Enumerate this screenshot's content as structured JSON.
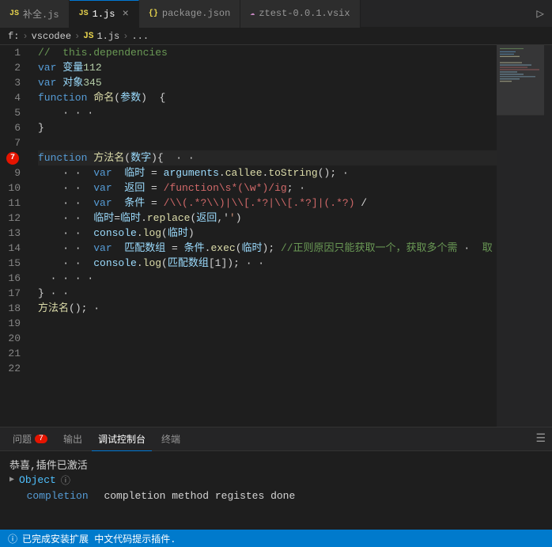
{
  "tabs": [
    {
      "id": "buquan",
      "icon": "JS",
      "icon_class": "tab-icon",
      "label": "补全.js",
      "active": false,
      "closeable": false
    },
    {
      "id": "1js",
      "icon": "JS",
      "icon_class": "tab-icon",
      "label": "1.js",
      "active": true,
      "closeable": true
    },
    {
      "id": "package",
      "icon": "{}",
      "icon_class": "tab-icon json",
      "label": "package.json",
      "active": false,
      "closeable": false
    },
    {
      "id": "vsix",
      "icon": "☁",
      "icon_class": "tab-icon vsix",
      "label": "ztest-0.0.1.vsix",
      "active": false,
      "closeable": false
    }
  ],
  "breadcrumb": {
    "items": [
      "f:",
      "vscodee",
      "JS",
      "1.js",
      "..."
    ]
  },
  "lines": [
    {
      "num": 1,
      "content": "comment_this_dependencies"
    },
    {
      "num": 2,
      "content": "var_112"
    },
    {
      "num": 3,
      "content": "var_345"
    },
    {
      "num": 4,
      "content": "function_named"
    },
    {
      "num": 5,
      "content": "dots"
    },
    {
      "num": 6,
      "content": "close_brace"
    },
    {
      "num": 7,
      "content": "empty"
    },
    {
      "num": 8,
      "content": "function_shuzhi"
    },
    {
      "num": 9,
      "content": "var_linshi_arguments"
    },
    {
      "num": 10,
      "content": "var_fanhui_regex"
    },
    {
      "num": 11,
      "content": "var_tiaojian"
    },
    {
      "num": 12,
      "content": "linshi_replace"
    },
    {
      "num": 13,
      "content": "console_log_linshi"
    },
    {
      "num": 14,
      "content": "var_pipeidingzu"
    },
    {
      "num": 15,
      "content": "console_log_pipeidingzu"
    },
    {
      "num": 16,
      "content": "dots2"
    },
    {
      "num": 17,
      "content": "empty2"
    },
    {
      "num": 18,
      "content": "method_call"
    },
    {
      "num": 19,
      "content": "empty3"
    },
    {
      "num": 20,
      "content": "empty4"
    },
    {
      "num": 21,
      "content": "empty5"
    },
    {
      "num": 22,
      "content": "empty6"
    }
  ],
  "panel": {
    "tabs": [
      {
        "label": "问题",
        "badge": "7",
        "active": false
      },
      {
        "label": "输出",
        "badge": "",
        "active": false
      },
      {
        "label": "调试控制台",
        "badge": "",
        "active": true
      },
      {
        "label": "终端",
        "badge": "",
        "active": false
      }
    ],
    "content": {
      "line1": "恭喜,插件已激活",
      "line2_key": "Object",
      "line2_icon": "ⓘ",
      "line3": "completion method registes done"
    }
  },
  "statusbar": {
    "icon": "ⓘ",
    "text": "已完成安装扩展 中文代码提示插件."
  }
}
